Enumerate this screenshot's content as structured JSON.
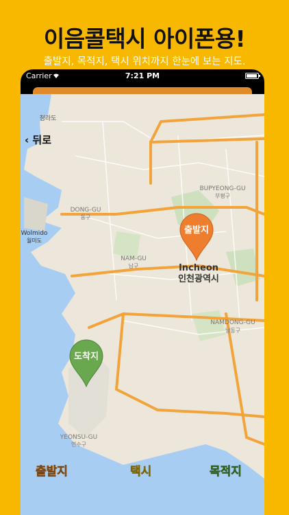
{
  "promo": {
    "headline": "이음콜택시 아이폰용!",
    "subline": "출발지, 목적지, 택시 위치까지 한눈에 보는 지도."
  },
  "status_bar": {
    "carrier": "Carrier",
    "time": "7:21 PM"
  },
  "nav": {
    "back_label": "‹ 뒤로"
  },
  "map": {
    "labels": {
      "chungra": "청라도",
      "dong_gu_en": "DONG-GU",
      "dong_gu_ko": "동구",
      "wolmido_en": "Wolmido",
      "wolmido_ko": "월미도",
      "bupyeong_en": "BUPYEONG-GU",
      "bupyeong_ko": "부평구",
      "incheon_en": "Incheon",
      "incheon_ko": "인천광역시",
      "nam_gu_en": "NAM-GU",
      "nam_gu_ko": "남구",
      "namdong_en": "NAMDONG-GU",
      "namdong_ko": "남동구",
      "yeonsu_en": "YEONSU-GU",
      "yeonsu_ko": "연수구"
    },
    "pins": {
      "origin_label": "출발지",
      "destination_label": "도착지",
      "origin_color": "#EE7E2D",
      "destination_color": "#6AA84F"
    }
  },
  "bottom_buttons": {
    "origin": "출발지",
    "taxi": "택시",
    "destination": "목적지"
  },
  "colors": {
    "background": "#F9B800",
    "water": "#A8CDF3",
    "land": "#E9E4D6",
    "highway": "#F2A33A"
  }
}
